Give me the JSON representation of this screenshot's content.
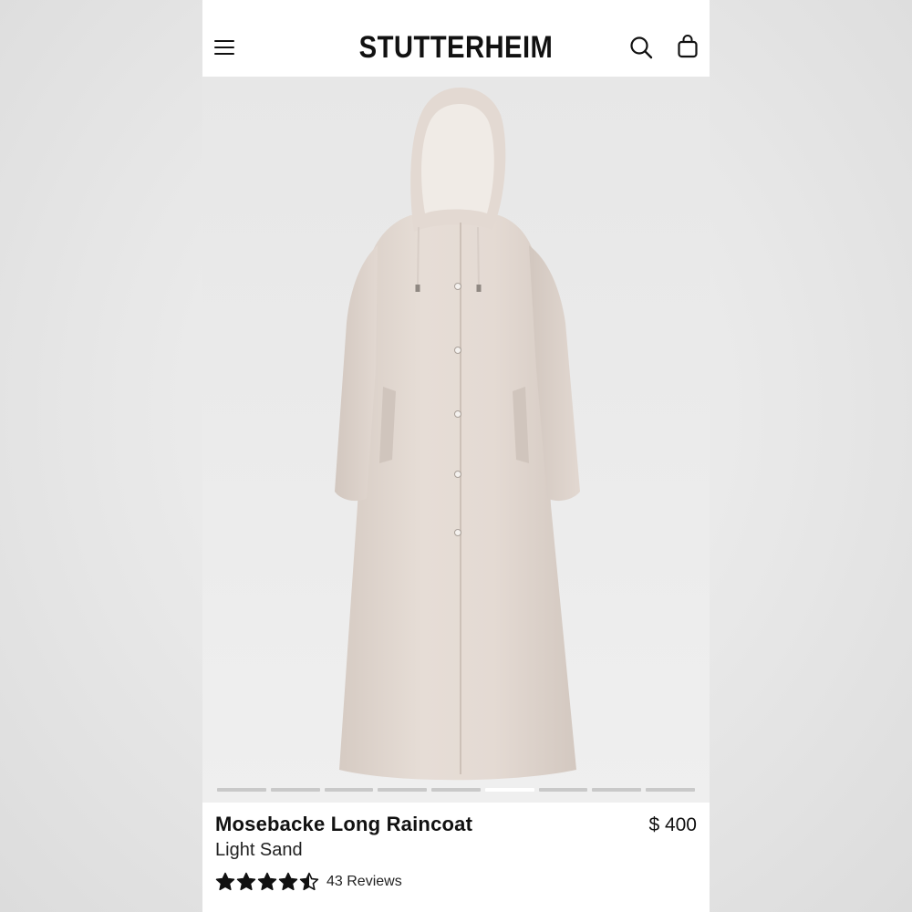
{
  "header": {
    "menu_icon": "hamburger-menu-icon",
    "brand": "STUTTERHEIM",
    "search_icon": "search-icon",
    "bag_icon": "shopping-bag-icon"
  },
  "gallery": {
    "image_count": 9,
    "active_index": 5
  },
  "product": {
    "name": "Mosebacke Long Raincoat",
    "price": "$ 400",
    "color": "Light Sand",
    "rating": 4.5,
    "rating_max": 5,
    "reviews_label": "43 Reviews"
  },
  "colors": {
    "coat": "#e0d6cf",
    "text": "#111111",
    "pager_inactive": "#c9c9c9",
    "pager_active": "#ffffff"
  }
}
